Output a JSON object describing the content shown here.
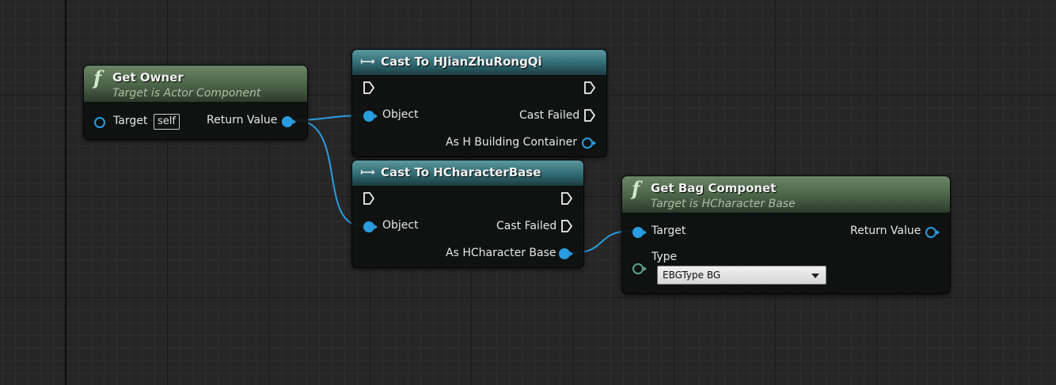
{
  "nodes": {
    "get_owner": {
      "title": "Get Owner",
      "subtitle": "Target is Actor Component",
      "icon": "function-icon",
      "inputs": {
        "target_label": "Target",
        "target_value": "self"
      },
      "outputs": {
        "return_label": "Return Value"
      }
    },
    "cast_hjianzhu": {
      "title": "Cast To HJianZhuRongQi",
      "icon": "cast-icon",
      "inputs": {
        "object_label": "Object"
      },
      "outputs": {
        "cast_failed_label": "Cast Failed",
        "as_label": "As H Building Container"
      }
    },
    "cast_hcharacter": {
      "title": "Cast To HCharacterBase",
      "icon": "cast-icon",
      "inputs": {
        "object_label": "Object"
      },
      "outputs": {
        "cast_failed_label": "Cast Failed",
        "as_label": "As HCharacter Base"
      }
    },
    "get_bag": {
      "title": "Get Bag Componet",
      "subtitle": "Target is HCharacter Base",
      "icon": "function-icon",
      "inputs": {
        "target_label": "Target",
        "type_label": "Type",
        "type_value": "EBGType BG"
      },
      "outputs": {
        "return_label": "Return Value"
      }
    }
  },
  "colors": {
    "object_pin": "#2a9de0",
    "enum_pin": "#5fa08a",
    "function_header": "#4a6347",
    "cast_header": "#2f6a72",
    "background": "#262626"
  }
}
